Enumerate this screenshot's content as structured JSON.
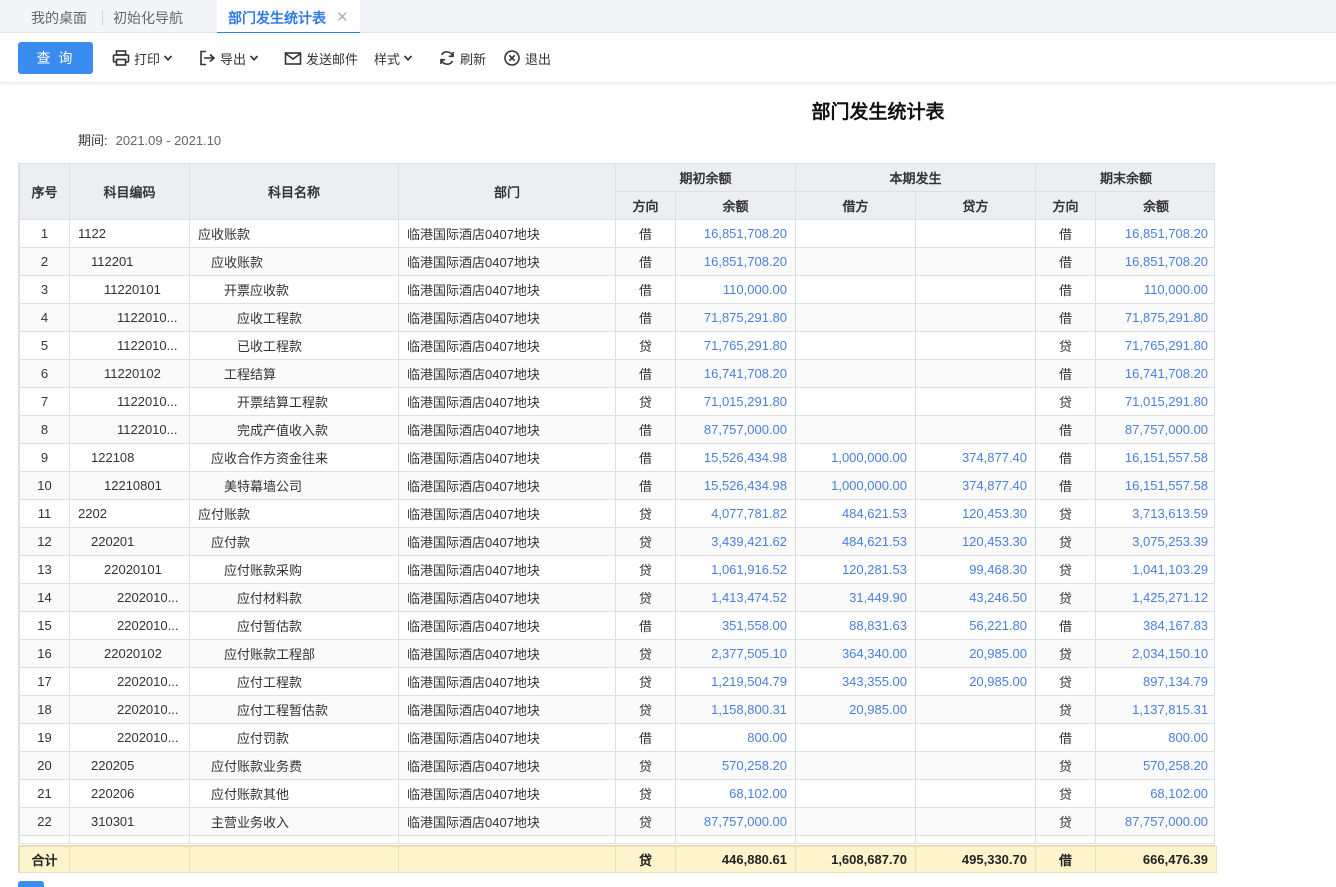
{
  "tabs": [
    {
      "label": "我的桌面"
    },
    {
      "label": "初始化导航"
    },
    {
      "label": "部门发生统计表",
      "active": true
    }
  ],
  "toolbar": {
    "query": "查 询",
    "print": "打印",
    "export": "导出",
    "email": "发送邮件",
    "style": "样式",
    "refresh": "刷新",
    "exit": "退出"
  },
  "report": {
    "title": "部门发生统计表",
    "period_label": "期间:",
    "period_value": "2021.09 - 2021.10"
  },
  "header": {
    "seq": "序号",
    "code": "科目编码",
    "name": "科目名称",
    "dept": "部门",
    "opening": "期初余额",
    "current": "本期发生",
    "closing": "期末余额",
    "direction": "方向",
    "balance": "余额",
    "debit": "借方",
    "credit": "贷方"
  },
  "rows": [
    {
      "seq": "1",
      "code": "1122",
      "level": 0,
      "name": "应收账款",
      "dept": "临港国际酒店0407地块",
      "od": "借",
      "ob": "16,851,708.20",
      "debit": "",
      "credit": "",
      "cd": "借",
      "cb": "16,851,708.20"
    },
    {
      "seq": "2",
      "code": "112201",
      "level": 1,
      "name": "应收账款",
      "dept": "临港国际酒店0407地块",
      "od": "借",
      "ob": "16,851,708.20",
      "debit": "",
      "credit": "",
      "cd": "借",
      "cb": "16,851,708.20"
    },
    {
      "seq": "3",
      "code": "11220101",
      "level": 2,
      "name": "开票应收款",
      "dept": "临港国际酒店0407地块",
      "od": "借",
      "ob": "110,000.00",
      "debit": "",
      "credit": "",
      "cd": "借",
      "cb": "110,000.00"
    },
    {
      "seq": "4",
      "code": "1122010...",
      "level": 3,
      "name": "应收工程款",
      "dept": "临港国际酒店0407地块",
      "od": "借",
      "ob": "71,875,291.80",
      "debit": "",
      "credit": "",
      "cd": "借",
      "cb": "71,875,291.80"
    },
    {
      "seq": "5",
      "code": "1122010...",
      "level": 3,
      "name": "已收工程款",
      "dept": "临港国际酒店0407地块",
      "od": "贷",
      "ob": "71,765,291.80",
      "debit": "",
      "credit": "",
      "cd": "贷",
      "cb": "71,765,291.80"
    },
    {
      "seq": "6",
      "code": "11220102",
      "level": 2,
      "name": "工程结算",
      "dept": "临港国际酒店0407地块",
      "od": "借",
      "ob": "16,741,708.20",
      "debit": "",
      "credit": "",
      "cd": "借",
      "cb": "16,741,708.20"
    },
    {
      "seq": "7",
      "code": "1122010...",
      "level": 3,
      "name": "开票结算工程款",
      "dept": "临港国际酒店0407地块",
      "od": "贷",
      "ob": "71,015,291.80",
      "debit": "",
      "credit": "",
      "cd": "贷",
      "cb": "71,015,291.80"
    },
    {
      "seq": "8",
      "code": "1122010...",
      "level": 3,
      "name": "完成产值收入款",
      "dept": "临港国际酒店0407地块",
      "od": "借",
      "ob": "87,757,000.00",
      "debit": "",
      "credit": "",
      "cd": "借",
      "cb": "87,757,000.00"
    },
    {
      "seq": "9",
      "code": "122108",
      "level": 1,
      "name": "应收合作方资金往来",
      "dept": "临港国际酒店0407地块",
      "od": "借",
      "ob": "15,526,434.98",
      "debit": "1,000,000.00",
      "credit": "374,877.40",
      "cd": "借",
      "cb": "16,151,557.58"
    },
    {
      "seq": "10",
      "code": "12210801",
      "level": 2,
      "name": "美特幕墙公司",
      "dept": "临港国际酒店0407地块",
      "od": "借",
      "ob": "15,526,434.98",
      "debit": "1,000,000.00",
      "credit": "374,877.40",
      "cd": "借",
      "cb": "16,151,557.58"
    },
    {
      "seq": "11",
      "code": "2202",
      "level": 0,
      "name": "应付账款",
      "dept": "临港国际酒店0407地块",
      "od": "贷",
      "ob": "4,077,781.82",
      "debit": "484,621.53",
      "credit": "120,453.30",
      "cd": "贷",
      "cb": "3,713,613.59"
    },
    {
      "seq": "12",
      "code": "220201",
      "level": 1,
      "name": "应付款",
      "dept": "临港国际酒店0407地块",
      "od": "贷",
      "ob": "3,439,421.62",
      "debit": "484,621.53",
      "credit": "120,453.30",
      "cd": "贷",
      "cb": "3,075,253.39"
    },
    {
      "seq": "13",
      "code": "22020101",
      "level": 2,
      "name": "应付账款采购",
      "dept": "临港国际酒店0407地块",
      "od": "贷",
      "ob": "1,061,916.52",
      "debit": "120,281.53",
      "credit": "99,468.30",
      "cd": "贷",
      "cb": "1,041,103.29"
    },
    {
      "seq": "14",
      "code": "2202010...",
      "level": 3,
      "name": "应付材料款",
      "dept": "临港国际酒店0407地块",
      "od": "贷",
      "ob": "1,413,474.52",
      "debit": "31,449.90",
      "credit": "43,246.50",
      "cd": "贷",
      "cb": "1,425,271.12"
    },
    {
      "seq": "15",
      "code": "2202010...",
      "level": 3,
      "name": "应付暂估款",
      "dept": "临港国际酒店0407地块",
      "od": "借",
      "ob": "351,558.00",
      "debit": "88,831.63",
      "credit": "56,221.80",
      "cd": "借",
      "cb": "384,167.83"
    },
    {
      "seq": "16",
      "code": "22020102",
      "level": 2,
      "name": "应付账款工程部",
      "dept": "临港国际酒店0407地块",
      "od": "贷",
      "ob": "2,377,505.10",
      "debit": "364,340.00",
      "credit": "20,985.00",
      "cd": "贷",
      "cb": "2,034,150.10"
    },
    {
      "seq": "17",
      "code": "2202010...",
      "level": 3,
      "name": "应付工程款",
      "dept": "临港国际酒店0407地块",
      "od": "贷",
      "ob": "1,219,504.79",
      "debit": "343,355.00",
      "credit": "20,985.00",
      "cd": "贷",
      "cb": "897,134.79"
    },
    {
      "seq": "18",
      "code": "2202010...",
      "level": 3,
      "name": "应付工程暂估款",
      "dept": "临港国际酒店0407地块",
      "od": "贷",
      "ob": "1,158,800.31",
      "debit": "20,985.00",
      "credit": "",
      "cd": "贷",
      "cb": "1,137,815.31"
    },
    {
      "seq": "19",
      "code": "2202010...",
      "level": 3,
      "name": "应付罚款",
      "dept": "临港国际酒店0407地块",
      "od": "借",
      "ob": "800.00",
      "debit": "",
      "credit": "",
      "cd": "借",
      "cb": "800.00"
    },
    {
      "seq": "20",
      "code": "220205",
      "level": 1,
      "name": "应付账款业务费",
      "dept": "临港国际酒店0407地块",
      "od": "贷",
      "ob": "570,258.20",
      "debit": "",
      "credit": "",
      "cd": "贷",
      "cb": "570,258.20"
    },
    {
      "seq": "21",
      "code": "220206",
      "level": 1,
      "name": "应付账款其他",
      "dept": "临港国际酒店0407地块",
      "od": "贷",
      "ob": "68,102.00",
      "debit": "",
      "credit": "",
      "cd": "贷",
      "cb": "68,102.00"
    },
    {
      "seq": "22",
      "code": "310301",
      "level": 1,
      "name": "主营业务收入",
      "dept": "临港国际酒店0407地块",
      "od": "贷",
      "ob": "87,757,000.00",
      "debit": "",
      "credit": "",
      "cd": "贷",
      "cb": "87,757,000.00"
    }
  ],
  "total": {
    "label": "合计",
    "od": "贷",
    "ob": "446,880.61",
    "debit": "1,608,687.70",
    "credit": "495,330.70",
    "cd": "借",
    "cb": "666,476.39"
  },
  "colors": {
    "accent": "#3b8cf1",
    "number": "#4a7fd8",
    "total_bg": "#fdf3cc",
    "header_bg": "#eceef1"
  },
  "icons": [
    "close-icon",
    "printer-icon",
    "export-icon",
    "mail-icon",
    "refresh-icon",
    "exit-icon",
    "chevron-down-icon"
  ]
}
